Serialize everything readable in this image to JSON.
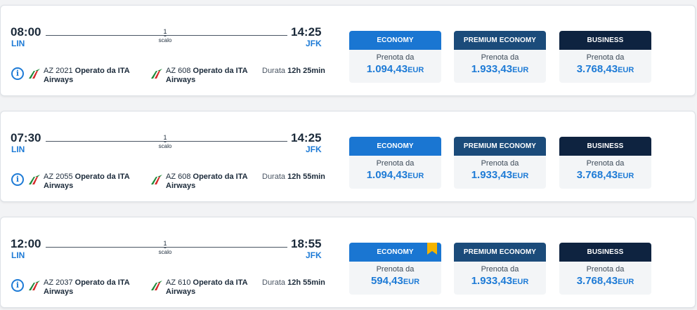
{
  "colors": {
    "accent_blue": "#1e7bd6",
    "economy_header": "#1a76d2",
    "premium_header": "#1b4b7a",
    "business_header": "#0e2340",
    "bookmark": "#f4b400"
  },
  "labels": {
    "stops_label": "scalo",
    "operated_by": "Operato da ITA",
    "operated_by_line2": "Airways",
    "duration_prefix": "Durata",
    "book_from": "Prenota da",
    "currency": "EUR"
  },
  "flights": [
    {
      "dep_time": "08:00",
      "dep_airport": "LIN",
      "arr_time": "14:25",
      "arr_airport": "JFK",
      "stops": "1",
      "seg1": "AZ 2021",
      "seg2": "AZ 608",
      "duration": "12h 25min",
      "fares": [
        {
          "class": "ECONOMY",
          "price": "1.094,43",
          "bookmark": false
        },
        {
          "class": "PREMIUM ECONOMY",
          "price": "1.933,43"
        },
        {
          "class": "BUSINESS",
          "price": "3.768,43"
        }
      ]
    },
    {
      "dep_time": "07:30",
      "dep_airport": "LIN",
      "arr_time": "14:25",
      "arr_airport": "JFK",
      "stops": "1",
      "seg1": "AZ 2055",
      "seg2": "AZ 608",
      "duration": "12h 55min",
      "fares": [
        {
          "class": "ECONOMY",
          "price": "1.094,43",
          "bookmark": false
        },
        {
          "class": "PREMIUM ECONOMY",
          "price": "1.933,43"
        },
        {
          "class": "BUSINESS",
          "price": "3.768,43"
        }
      ]
    },
    {
      "dep_time": "12:00",
      "dep_airport": "LIN",
      "arr_time": "18:55",
      "arr_airport": "JFK",
      "stops": "1",
      "seg1": "AZ 2037",
      "seg2": "AZ 610",
      "duration": "12h 55min",
      "fares": [
        {
          "class": "ECONOMY",
          "price": "594,43",
          "bookmark": true
        },
        {
          "class": "PREMIUM ECONOMY",
          "price": "1.933,43"
        },
        {
          "class": "BUSINESS",
          "price": "3.768,43"
        }
      ]
    }
  ]
}
